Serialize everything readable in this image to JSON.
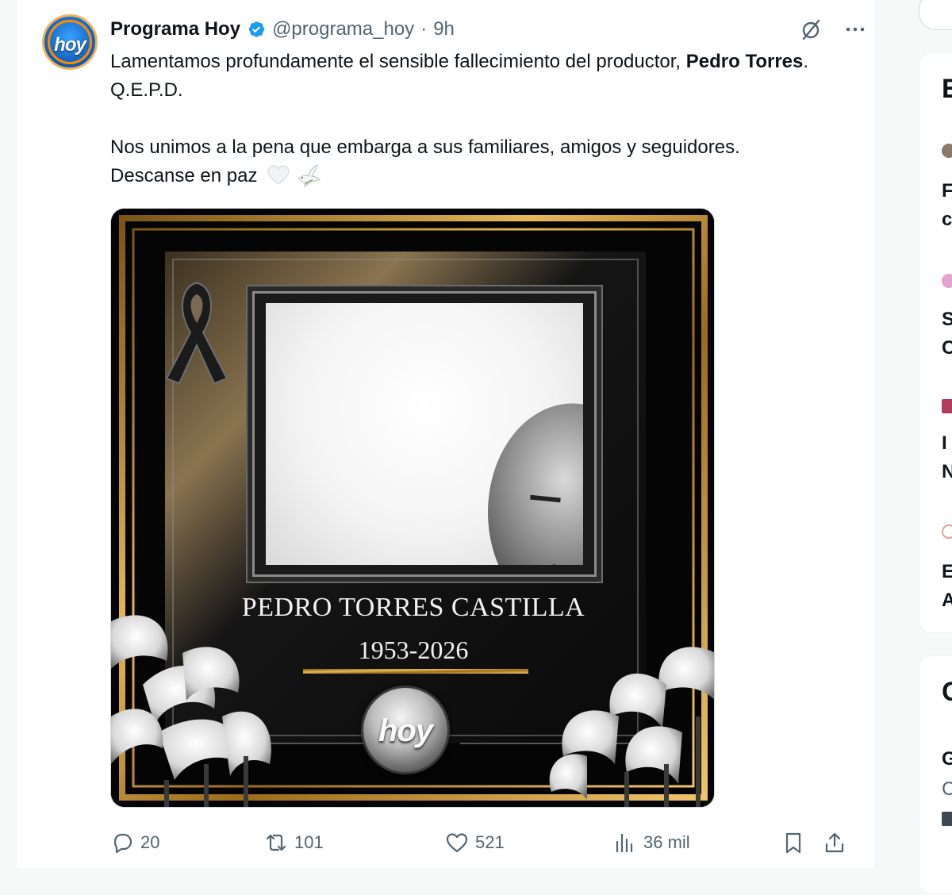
{
  "tweet": {
    "display_name": "Programa Hoy",
    "handle": "@programa_hoy",
    "separator": "·",
    "time": "9h",
    "avatar_text": "hoy",
    "text": {
      "line1_pre": "Lamentamos profundamente el sensible fallecimiento del productor, ",
      "line1_bold": "Pedro Torres",
      "line1_post": ". Q.E.P.D.",
      "line2": "Nos unimos a la pena que embarga a sus familiares, amigos y seguidores.",
      "line3": "Descanse en paz"
    },
    "media": {
      "name": "PEDRO TORRES CASTILLA",
      "years": "1953-2026",
      "logo_text": "hoy"
    },
    "stats": {
      "replies": "20",
      "retweets": "101",
      "likes": "521",
      "views": "36 mil"
    }
  },
  "sidebar": {
    "heading1": "E",
    "heading2": "C",
    "items": [
      "F",
      "c",
      "S",
      "C",
      "I",
      "N",
      "E",
      "A",
      "G",
      "C"
    ]
  },
  "icons": {
    "verified": "verified-badge-icon",
    "grok": "grok-icon",
    "more": "more-icon",
    "reply": "reply-icon",
    "retweet": "retweet-icon",
    "like": "heart-icon",
    "views": "views-icon",
    "bookmark": "bookmark-icon",
    "share": "share-icon"
  },
  "colors": {
    "accent": "#1d9bf0",
    "muted": "#536471",
    "gold": "#c9962e"
  }
}
